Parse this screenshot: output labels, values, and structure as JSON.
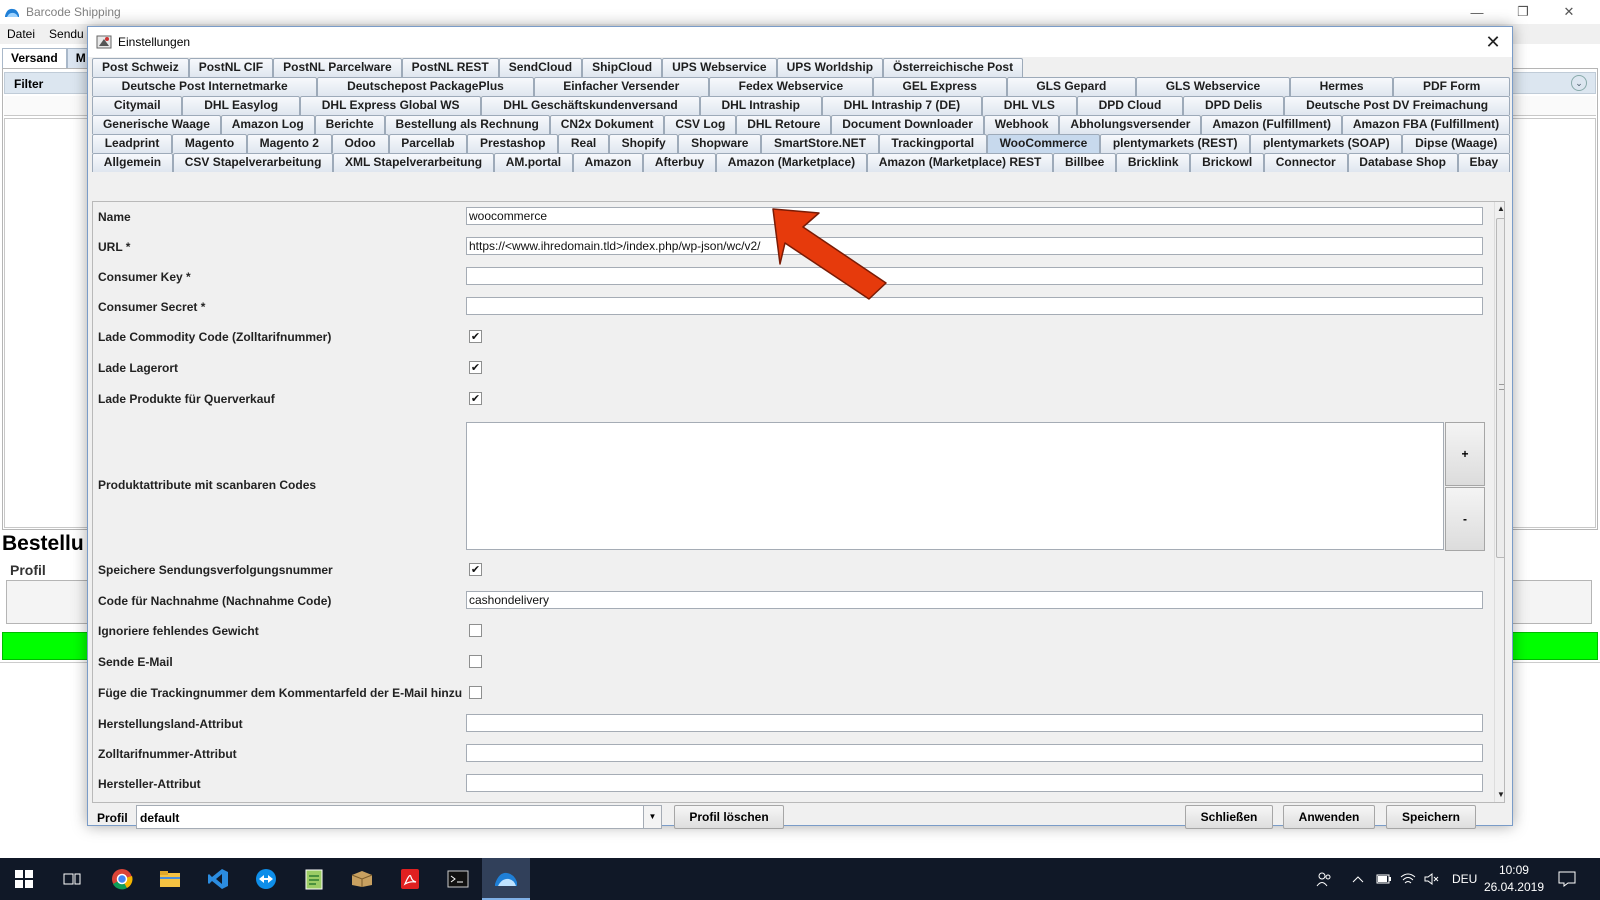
{
  "app": {
    "title": "Barcode Shipping",
    "menu": [
      "Datei",
      "Sendu"
    ],
    "tabs": [
      "Versand",
      "M"
    ],
    "filter_label": "Filter",
    "section_title": "Bestellu",
    "profil_label": "Profil"
  },
  "dialog": {
    "title": "Einstellungen",
    "tab_rows": [
      [
        "Post Schweiz",
        "PostNL CIF",
        "PostNL Parcelware",
        "PostNL REST",
        "SendCloud",
        "ShipCloud",
        "UPS Webservice",
        "UPS Worldship",
        "Österreichische Post"
      ],
      [
        "Deutsche Post Internetmarke",
        "Deutschepost PackagePlus",
        "Einfacher Versender",
        "Fedex Webservice",
        "GEL Express",
        "GLS Gepard",
        "GLS Webservice",
        "Hermes",
        "PDF Form"
      ],
      [
        "Citymail",
        "DHL Easylog",
        "DHL Express Global WS",
        "DHL Geschäftskundenversand",
        "DHL Intraship",
        "DHL Intraship 7 (DE)",
        "DHL VLS",
        "DPD Cloud",
        "DPD Delis",
        "Deutsche Post DV Freimachung"
      ],
      [
        "Generische Waage",
        "Amazon Log",
        "Berichte",
        "Bestellung als Rechnung",
        "CN2x Dokument",
        "CSV Log",
        "DHL Retoure",
        "Document Downloader",
        "Webhook",
        "Abholungsversender",
        "Amazon (Fulfillment)",
        "Amazon FBA (Fulfillment)"
      ],
      [
        "Leadprint",
        "Magento",
        "Magento 2",
        "Odoo",
        "Parcellab",
        "Prestashop",
        "Real",
        "Shopify",
        "Shopware",
        "SmartStore.NET",
        "Trackingportal",
        "WooCommerce",
        "plentymarkets (REST)",
        "plentymarkets (SOAP)",
        "Dipse (Waage)"
      ],
      [
        "Allgemein",
        "CSV Stapelverarbeitung",
        "XML Stapelverarbeitung",
        "AM.portal",
        "Amazon",
        "Afterbuy",
        "Amazon (Marketplace)",
        "Amazon (Marketplace) REST",
        "Billbee",
        "Bricklink",
        "Brickowl",
        "Connector",
        "Database Shop",
        "Ebay"
      ]
    ],
    "selected_tab": "WooCommerce",
    "fields": {
      "name": {
        "label": "Name",
        "value": "woocommerce"
      },
      "url": {
        "label": "URL *",
        "value": "https://<www.ihredomain.tld>/index.php/wp-json/wc/v2/"
      },
      "consumer_key": {
        "label": "Consumer Key *",
        "value": ""
      },
      "consumer_secret": {
        "label": "Consumer Secret *",
        "value": ""
      },
      "commodity": {
        "label": "Lade Commodity Code (Zolltarifnummer)",
        "checked": true
      },
      "lagerort": {
        "label": "Lade Lagerort",
        "checked": true
      },
      "querverkauf": {
        "label": "Lade Produkte für Querverkauf",
        "checked": true
      },
      "produktattribute": {
        "label": "Produktattribute mit scanbaren Codes",
        "add": "+",
        "remove": "-"
      },
      "sendungsverfolgung": {
        "label": "Speichere Sendungsverfolgungsnummer",
        "checked": true
      },
      "nachnahme": {
        "label": "Code für Nachnahme (Nachnahme Code)",
        "value": "cashondelivery"
      },
      "gewicht": {
        "label": "Ignoriere fehlendes Gewicht",
        "checked": false
      },
      "email": {
        "label": "Sende E-Mail",
        "checked": false
      },
      "tracking_kommentar": {
        "label": "Füge die Trackingnummer dem Kommentarfeld der E-Mail hinzu",
        "checked": false
      },
      "herstellungsland": {
        "label": "Herstellungsland-Attribut",
        "value": ""
      },
      "zolltarif": {
        "label": "Zolltarifnummer-Attribut",
        "value": ""
      },
      "hersteller": {
        "label": "Hersteller-Attribut",
        "value": ""
      }
    },
    "footer": {
      "profil_label": "Profil",
      "profil_value": "default",
      "delete_profile": "Profil löschen",
      "close": "Schließen",
      "apply": "Anwenden",
      "save": "Speichern"
    }
  },
  "annotation": {
    "color": "#e63a0c",
    "icon": "red-arrow"
  },
  "taskbar": {
    "icons": [
      "windows-start-icon",
      "task-view-icon",
      "chrome-icon",
      "file-explorer-icon",
      "vscode-icon",
      "teamviewer-icon",
      "notepad-plus-icon",
      "package-icon",
      "acrobat-icon",
      "terminal-icon",
      "barcode-shipping-icon"
    ],
    "language": "DEU",
    "time": "10:09",
    "date": "26.04.2019"
  }
}
